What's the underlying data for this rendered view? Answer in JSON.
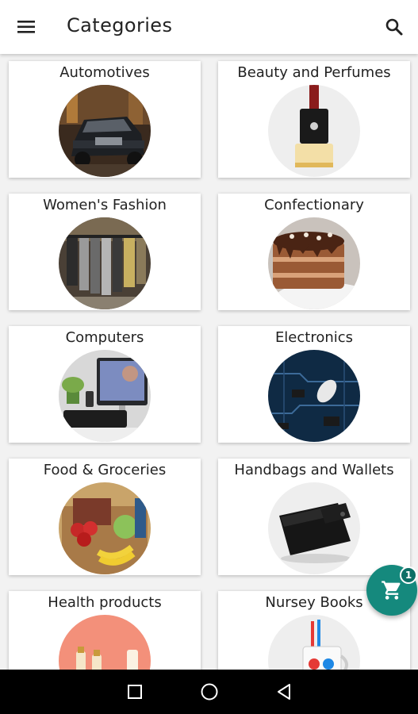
{
  "appbar": {
    "title": "Categories",
    "menu_icon": "hamburger-menu-icon",
    "search_icon": "search-icon"
  },
  "categories": [
    {
      "label": "Automotives",
      "image": "car-photo"
    },
    {
      "label": "Beauty and Perfumes",
      "image": "perfume-bottle-photo"
    },
    {
      "label": "Women's Fashion",
      "image": "clothing-rack-photo"
    },
    {
      "label": "Confectionary",
      "image": "chocolate-cake-photo"
    },
    {
      "label": "Computers",
      "image": "desktop-computer-photo"
    },
    {
      "label": "Electronics",
      "image": "circuit-board-photo"
    },
    {
      "label": "Food & Groceries",
      "image": "grocery-box-photo"
    },
    {
      "label": "Handbags and Wallets",
      "image": "black-wallet-photo"
    },
    {
      "label": "Health products",
      "image": "health-bottles-photo"
    },
    {
      "label": "Nursey Books",
      "image": "colorful-mug-photo"
    }
  ],
  "cart": {
    "icon": "shopping-cart-icon",
    "count": "1",
    "color": "#15897d"
  },
  "system_nav": {
    "recents_icon": "square-recents-icon",
    "home_icon": "circle-home-icon",
    "back_icon": "triangle-back-icon"
  }
}
